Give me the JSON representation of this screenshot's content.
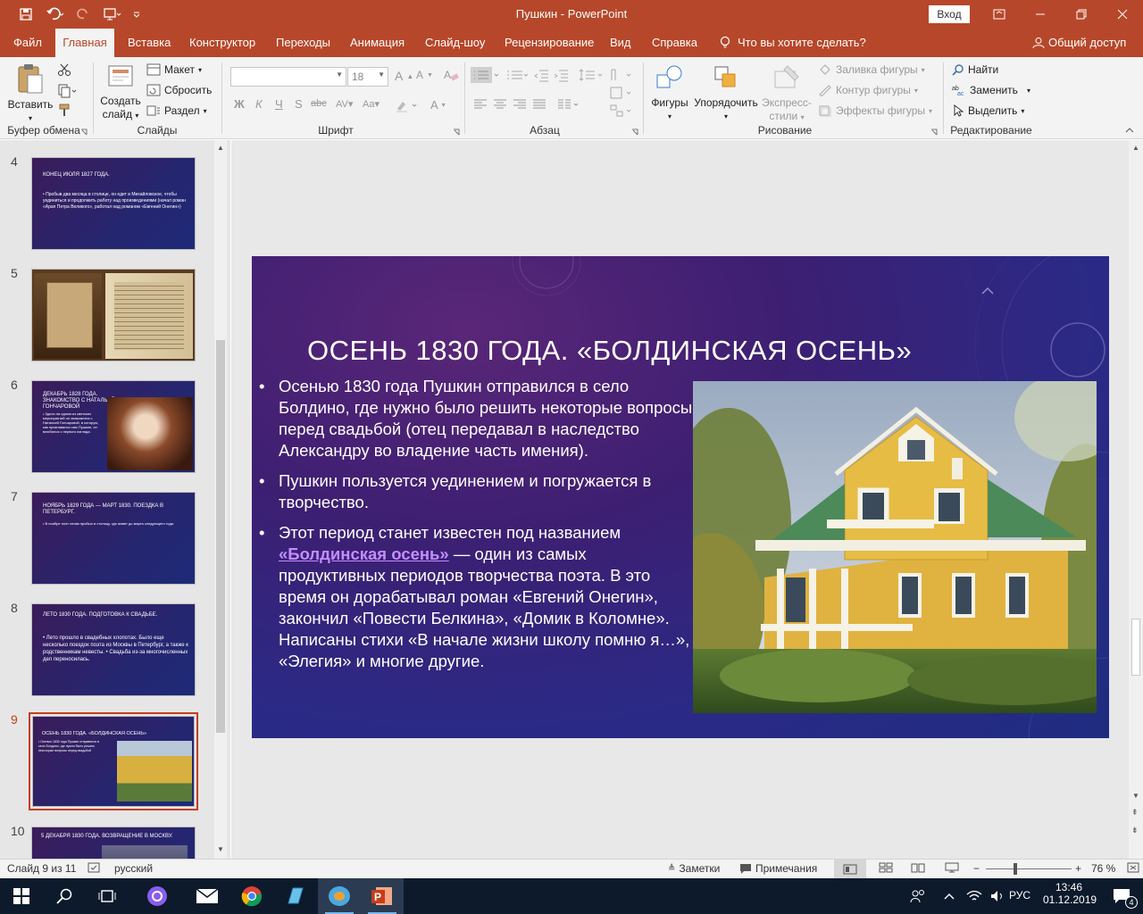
{
  "titlebar": {
    "title": "Пушкин  -  PowerPoint",
    "signin": "Вход"
  },
  "menu": {
    "tabs": [
      "Файл",
      "Главная",
      "Вставка",
      "Конструктор",
      "Переходы",
      "Анимация",
      "Слайд-шоу",
      "Рецензирование",
      "Вид",
      "Справка"
    ],
    "tell_me": "Что вы хотите сделать?",
    "share": "Общий доступ"
  },
  "ribbon": {
    "clipboard": {
      "paste": "Вставить",
      "label": "Буфер обмена"
    },
    "slides": {
      "new_slide_1": "Создать",
      "new_slide_2": "слайд",
      "layout": "Макет",
      "reset": "Сбросить",
      "section": "Раздел",
      "label": "Слайды"
    },
    "font": {
      "size": "18",
      "label": "Шрифт"
    },
    "paragraph": {
      "label": "Абзац"
    },
    "drawing": {
      "shapes": "Фигуры",
      "arrange": "Упорядочить",
      "quick_styles_1": "Экспресс-",
      "quick_styles_2": "стили",
      "fill": "Заливка фигуры",
      "outline": "Контур фигуры",
      "effects": "Эффекты фигуры",
      "label": "Рисование"
    },
    "editing": {
      "find": "Найти",
      "replace": "Заменить",
      "select": "Выделить",
      "label": "Редактирование"
    }
  },
  "thumbnails": [
    {
      "num": "4",
      "title": "КОНЕЦ ИЮЛЯ 1827 ГОДА.",
      "body": "• Пробыв два месяца в столице, он едет в Михайловское, чтобы уединиться и продолжить работу над произведениями (начал роман «Арап Петра Великого», работал над романом «Евгений Онегин»)"
    },
    {
      "num": "5",
      "title": "",
      "body": ""
    },
    {
      "num": "6",
      "title": "ДЕКАБРЬ 1828 ГОДА. ЗНАКОМСТВО С НАТАЛЬЕЙ ГОНЧАРОВОЙ",
      "body": "• Здесь на одном из светских мероприятий он знакомится с Натальей Гончаровой, в которую, как признавался сам Пушкин, он влюбился с первого взгляда."
    },
    {
      "num": "7",
      "title": "НОЯБРЬ 1829 ГОДА — МАРТ 1830. ПОЕЗДКА В ПЕТЕРБУРГ.",
      "body": "• В ноябре поэт снова прибыл в столицу, где живет до марта следующего года."
    },
    {
      "num": "8",
      "title": "ЛЕТО 1830 ГОДА. ПОДГОТОВКА К СВАДЬБЕ.",
      "body": "• Лето прошло в свадебных хлопотах. Было еще несколько поездок поэта из Москвы в Петербург, а также к родственникам невесты. • Свадьба из-за многочисленных дел переносилась."
    },
    {
      "num": "9",
      "title": "ОСЕНЬ 1830 ГОДА. «БОЛДИНСКАЯ ОСЕНЬ»",
      "body": "• Осенью 1830 года Пушкин отправился в село Болдино, где нужно было решить некоторые вопросы перед свадьбой"
    },
    {
      "num": "10",
      "title": "5 ДЕКАБРЯ 1830 ГОДА. ВОЗВРАЩЕНИЕ В МОСКВУ.",
      "body": ""
    }
  ],
  "slide": {
    "title": "ОСЕНЬ 1830 ГОДА. «БОЛДИНСКАЯ ОСЕНЬ»",
    "bullet1": "Осенью 1830 года Пушкин отправился в село Болдино, где нужно было решить некоторые вопросы перед свадьбой (отец передавал в наследство Александру во владение часть имения).",
    "bullet2": "Пушкин пользуется уединением и погружается в творчество.",
    "bullet3_pre": "Этот период станет известен под названием ",
    "bullet3_link": "«Болдинская осень»",
    "bullet3_post": " — один из самых продуктивных периодов творчества поэта. В это время он дорабатывал роман «Евгений Онегин», закончил «Повести Белкина», «Домик в Коломне». Написаны стихи «В начале жизни школу помню я…», «Элегия» и многие другие."
  },
  "status": {
    "slide_counter": "Слайд 9 из 11",
    "language": "русский",
    "notes": "Заметки",
    "comments": "Примечания",
    "zoom": "76 %"
  },
  "taskbar": {
    "language": "РУС",
    "time": "13:46",
    "date": "01.12.2019",
    "notifications": "4"
  },
  "colors": {
    "accent": "#b7472a",
    "selection": "#c43e1c",
    "link": "#c58cff"
  }
}
